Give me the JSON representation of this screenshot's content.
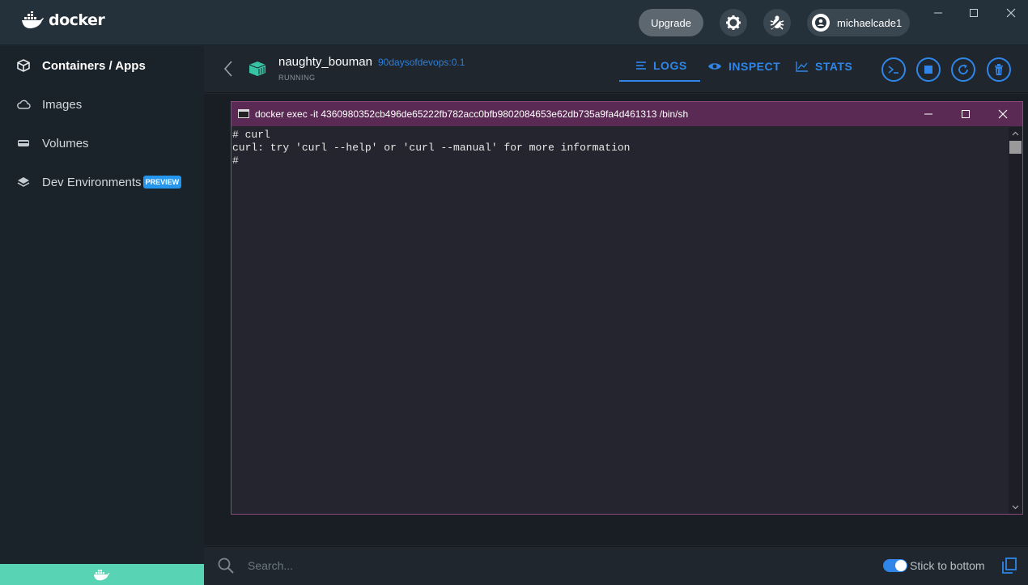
{
  "app": {
    "brand": "docker",
    "upgrade_label": "Upgrade",
    "username": "michaelcade1"
  },
  "sidebar": {
    "items": [
      {
        "label": "Containers / Apps",
        "icon": "containers-icon",
        "active": true
      },
      {
        "label": "Images",
        "icon": "cloud-icon",
        "active": false
      },
      {
        "label": "Volumes",
        "icon": "volume-icon",
        "active": false
      },
      {
        "label": "Dev Environments",
        "icon": "dev-environments-icon",
        "active": false,
        "badge": "PREVIEW"
      }
    ]
  },
  "container": {
    "name": "naughty_bouman",
    "image": "90daysofdevops:0.1",
    "status": "RUNNING"
  },
  "tabs": [
    {
      "label": "LOGS",
      "icon": "logs-icon",
      "active": true
    },
    {
      "label": "INSPECT",
      "icon": "eye-icon",
      "active": false
    },
    {
      "label": "STATS",
      "icon": "chart-icon",
      "active": false
    }
  ],
  "actions": [
    "cli-icon",
    "stop-icon",
    "restart-icon",
    "delete-icon"
  ],
  "terminal": {
    "title": "docker  exec -it 4360980352cb496de65222fb782acc0bfb9802084653e62db735a9fa4d461313 /bin/sh",
    "lines": [
      "# curl",
      "curl: try 'curl --help' or 'curl --manual' for more information",
      "#"
    ]
  },
  "footer": {
    "search_placeholder": "Search...",
    "stick_to_bottom_label": "Stick to bottom",
    "stick_to_bottom_on": true
  },
  "colors": {
    "accent": "#2f86e8",
    "sidebar_footer": "#58d4b4",
    "terminal_titlebar": "#5a2a54"
  }
}
